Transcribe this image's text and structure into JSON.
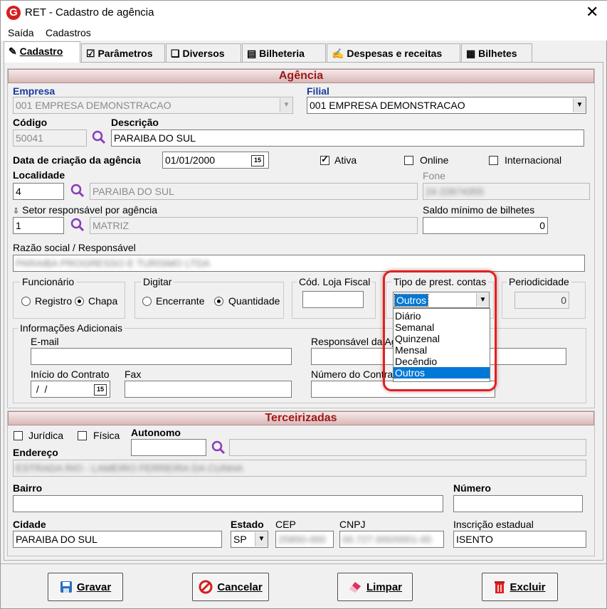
{
  "window": {
    "title": "RET - Cadastro de agência"
  },
  "menu": [
    "Saída",
    "Cadastros"
  ],
  "tabs": [
    "Cadastro",
    "Parâmetros",
    "Diversos",
    "Bilheteria",
    "Despesas e receitas",
    "Bilhetes"
  ],
  "agencia": {
    "header": "Agência",
    "empresa_label": "Empresa",
    "empresa_value": "001 EMPRESA DEMONSTRACAO",
    "filial_label": "Filial",
    "filial_value": "001 EMPRESA DEMONSTRACAO",
    "codigo_label": "Código",
    "codigo_value": "50041",
    "descricao_label": "Descrição",
    "descricao_value": "PARAIBA DO SUL",
    "data_label": "Data de criação da agência",
    "data_value": "01/01/2000",
    "ativa_label": "Ativa",
    "online_label": "Online",
    "internacional_label": "Internacional",
    "localidade_label": "Localidade",
    "localidade_code": "4",
    "localidade_value": "PARAIBA DO SUL",
    "fone_label": "Fone",
    "fone_value": "24 22674355",
    "setor_label": "Setor responsável por agência",
    "setor_code": "1",
    "setor_value": "MATRIZ",
    "saldo_label": "Saldo mínimo de bilhetes",
    "saldo_value": "0",
    "razao_label": "Razão social / Responsável",
    "razao_value": "PARAIBA PROGRESSO E TURISMO LTDA",
    "funcionario_label": "Funcionário",
    "registro_label": "Registro",
    "chapa_label": "Chapa",
    "digitar_label": "Digitar",
    "encerrante_label": "Encerrante",
    "quantidade_label": "Quantidade",
    "loja_label": "Cód. Loja Fiscal",
    "tipo_label": "Tipo de prest. contas",
    "tipo_value": "Outros",
    "tipo_options": [
      "Diário",
      "Semanal",
      "Quinzenal",
      "Mensal",
      "Decêndio",
      "Outros"
    ],
    "periodicidade_label": "Periodicidade",
    "periodicidade_value": "0",
    "info_label": "Informações Adicionais",
    "email_label": "E-mail",
    "responsavel_label": "Responsável da Agência",
    "inicio_label": "Início do Contrato",
    "inicio_value": " /  /",
    "fax_label": "Fax",
    "numero_contrato_label": "Número do Contrato"
  },
  "terceirizadas": {
    "header": "Terceirizadas",
    "juridica_label": "Jurídica",
    "fisica_label": "Física",
    "autonomo_label": "Autonomo",
    "endereco_label": "Endereço",
    "endereco_value": "ESTRADA RIO - LAMEIRO FERREIRA DA CUNHA",
    "bairro_label": "Bairro",
    "numero_label": "Número",
    "cidade_label": "Cidade",
    "cidade_value": "PARAIBA DO SUL",
    "estado_label": "Estado",
    "estado_value": "SP",
    "cep_label": "CEP",
    "cep_value": "25850-000",
    "cnpj_label": "CNPJ",
    "cnpj_value": "00.727.000/0001-00",
    "inscricao_label": "Inscrição estadual",
    "inscricao_value": "ISENTO"
  },
  "buttons": {
    "gravar": "Gravar",
    "cancelar": "Cancelar",
    "limpar": "Limpar",
    "excluir": "Excluir"
  },
  "colors": {
    "accent": "#0078d7",
    "header_text": "#a01818",
    "highlight_ring": "#e02020"
  }
}
